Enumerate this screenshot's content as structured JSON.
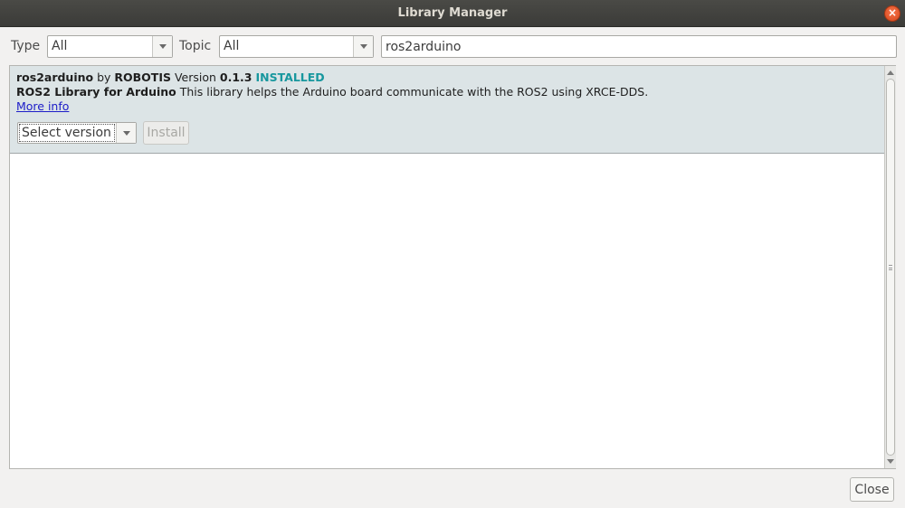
{
  "window": {
    "title": "Library Manager",
    "close_glyph": "×"
  },
  "filters": {
    "type_label": "Type",
    "type_value": "All",
    "topic_label": "Topic",
    "topic_value": "All"
  },
  "search": {
    "value": "ros2arduino"
  },
  "library": {
    "name": "ros2arduino",
    "by": " by ",
    "author": "ROBOTIS",
    "version_label": " Version ",
    "version": "0.1.3",
    "status": "INSTALLED",
    "title": "ROS2 Library for Arduino",
    "description": " This library helps the Arduino board communicate with the ROS2 using XRCE-DDS.",
    "more_info": "More info",
    "select_version": "Select version",
    "install_label": "Install"
  },
  "footer": {
    "close_label": "Close"
  },
  "colors": {
    "installed": "#17979e",
    "row_selected": "#dce4e6",
    "titlebar": "#3b3b38",
    "close_button": "#e65a2c"
  },
  "icons": {
    "window_close": "close-icon",
    "dropdown": "chevron-down-icon",
    "scroll_up": "arrow-up-icon",
    "scroll_down": "arrow-down-icon"
  }
}
